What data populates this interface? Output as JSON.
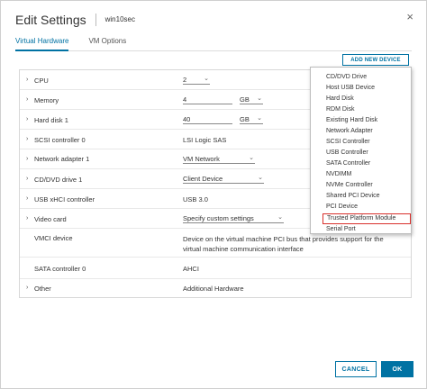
{
  "dialog": {
    "title": "Edit Settings",
    "vm_name": "win10sec",
    "close_glyph": "×"
  },
  "tabs": [
    {
      "label": "Virtual Hardware"
    },
    {
      "label": "VM Options"
    }
  ],
  "toolbar": {
    "add_new_device": "ADD NEW DEVICE"
  },
  "hardware": {
    "cpu": {
      "label": "CPU",
      "value": "2"
    },
    "memory": {
      "label": "Memory",
      "value": "4",
      "unit": "GB"
    },
    "hard_disk": {
      "label": "Hard disk 1",
      "value": "40",
      "unit": "GB"
    },
    "scsi": {
      "label": "SCSI controller 0",
      "value": "LSI Logic SAS"
    },
    "network": {
      "label": "Network adapter 1",
      "value": "VM Network"
    },
    "cddvd": {
      "label": "CD/DVD drive 1",
      "value": "Client Device"
    },
    "usb": {
      "label": "USB xHCI controller",
      "value": "USB 3.0"
    },
    "video": {
      "label": "Video card",
      "value": "Specify custom settings"
    },
    "vmci": {
      "label": "VMCI device",
      "value": "Device on the virtual machine PCI bus that provides support for the virtual machine communication interface"
    },
    "sata": {
      "label": "SATA controller 0",
      "value": "AHCI"
    },
    "other": {
      "label": "Other",
      "value": "Additional Hardware"
    }
  },
  "menu": {
    "items": [
      "CD/DVD Drive",
      "Host USB Device",
      "Hard Disk",
      "RDM Disk",
      "Existing Hard Disk",
      "Network Adapter",
      "SCSI Controller",
      "USB Controller",
      "SATA Controller",
      "NVDIMM",
      "NVMe Controller",
      "Shared PCI Device",
      "PCI Device",
      "Trusted Platform Module",
      "Serial Port"
    ],
    "highlighted_item": "Trusted Platform Module",
    "highlight_color": "#d9302c"
  },
  "footer": {
    "cancel": "CANCEL",
    "ok": "OK"
  },
  "colors": {
    "accent": "#0072a3"
  },
  "icons": {
    "expand": "›",
    "dropdown": "⌄"
  }
}
